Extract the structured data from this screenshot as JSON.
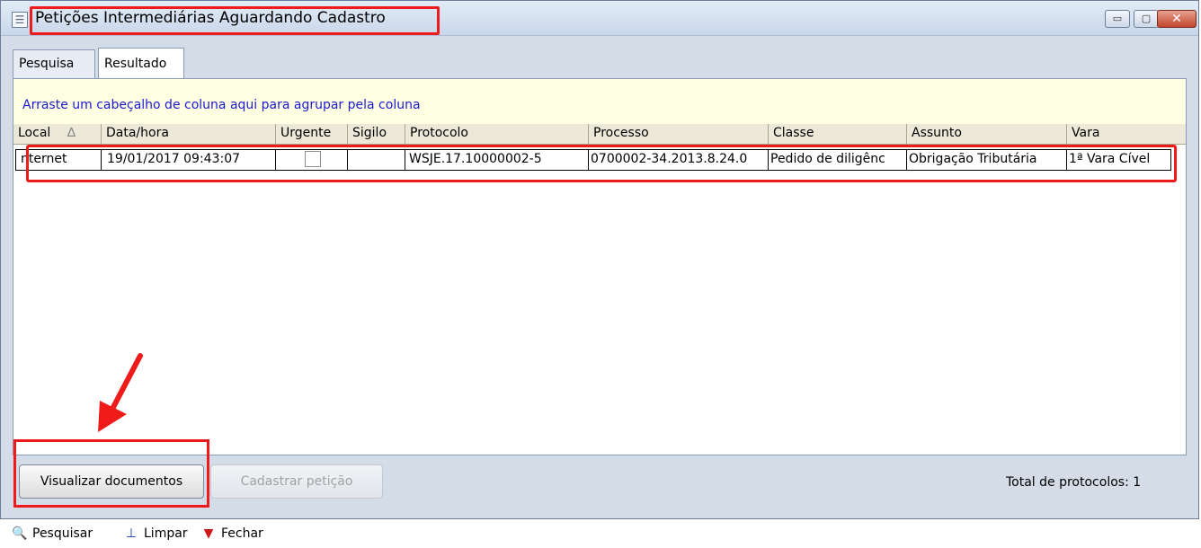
{
  "window": {
    "title": "Petições Intermediárias Aguardando Cadastro",
    "minimize_label": "▭",
    "maximize_label": "▢",
    "close_label": "✕"
  },
  "tabs": [
    {
      "label": "Pesquisa",
      "active": false
    },
    {
      "label": "Resultado",
      "active": true
    }
  ],
  "grid": {
    "group_hint": "Arraste um cabeçalho de coluna aqui para agrupar pela coluna",
    "sort_indicator": "∆",
    "columns": [
      "Local",
      "Data/hora",
      "Urgente",
      "Sigilo",
      "Protocolo",
      "Processo",
      "Classe",
      "Assunto",
      "Vara"
    ],
    "rows": [
      {
        "local": "nternet",
        "data_hora": "19/01/2017 09:43:07",
        "urgente": false,
        "sigilo": "",
        "protocolo": "WSJE.17.10000002-5",
        "processo": "0700002-34.2013.8.24.0",
        "classe": "Pedido de diligênc",
        "assunto": "Obrigação Tributária",
        "vara": "1ª Vara Cível"
      }
    ]
  },
  "actions": {
    "visualizar": "Visualizar documentos",
    "cadastrar": "Cadastrar petição"
  },
  "status": {
    "total_text": "Total de protocolos: 1"
  },
  "toolbar": {
    "pesquisar": "Pesquisar",
    "limpar": "Limpar",
    "fechar": "Fechar"
  },
  "colors": {
    "annotation": "#ef1b1b",
    "group_hint_text": "#1a1ad1"
  }
}
